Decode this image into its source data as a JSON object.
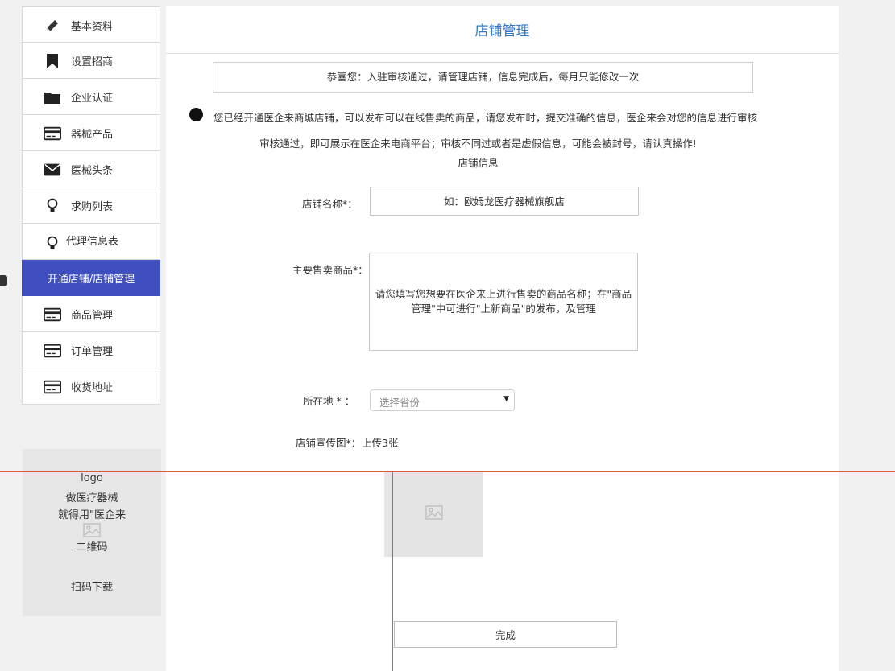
{
  "sidebar": {
    "items": [
      {
        "label": "基本资料",
        "icon": "pencil-icon"
      },
      {
        "label": "设置招商",
        "icon": "bookmark-icon"
      },
      {
        "label": "企业认证",
        "icon": "folder-icon"
      },
      {
        "label": "器械产品",
        "icon": "card-icon"
      },
      {
        "label": "医械头条",
        "icon": "envelope-icon"
      },
      {
        "label": "求购列表",
        "icon": "lightbulb-icon"
      },
      {
        "label": "代理信息表",
        "icon": "lightbulb-icon"
      },
      {
        "label": "开通店铺/店铺管理",
        "active": true
      },
      {
        "label": "商品管理",
        "icon": "card-icon"
      },
      {
        "label": "订单管理",
        "icon": "card-icon"
      },
      {
        "label": "收货地址",
        "icon": "card-icon"
      }
    ],
    "active_color": "#3f4fbf"
  },
  "promo": {
    "logo": "logo",
    "line1": "做医疗器械",
    "line2": "就得用\"医企来",
    "qr_label": "二维码",
    "download": "扫码下载"
  },
  "main": {
    "title": "店铺管理",
    "title_color": "#2f79c9",
    "notice": "恭喜您：入驻审核通过，请管理店铺，信息完成后，每月只能修改一次",
    "info_line1": "您已经开通医企来商城店铺，可以发布可以在线售卖的商品，请您发布时，提交准确的信息，医企来会对您的信息进行审核",
    "info_line2": "审核通过，即可展示在医企来电商平台；审核不同过或者是虚假信息，可能会被封号，请认真操作!",
    "section_title": "店铺信息"
  },
  "form": {
    "name_label": "店铺名称*：",
    "name_placeholder": "如：欧姆龙医疗器械旗舰店",
    "goods_label": "主要售卖商品*：",
    "goods_placeholder": "请您填写您想要在医企来上进行售卖的商品名称；在\"商品管理\"中可进行\"上新商品\"的发布，及管理",
    "location_label": "所在地 * ：",
    "location_placeholder": "选择省份",
    "banner_label": "店铺宣传图*：",
    "banner_hint": "上传3张",
    "submit_label": "完成"
  }
}
